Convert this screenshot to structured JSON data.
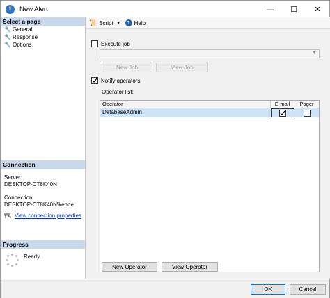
{
  "window": {
    "title": "New Alert",
    "minimize": "—",
    "maximize": "☐",
    "close": "✕"
  },
  "left_panel": {
    "select_page_header": "Select a page",
    "pages": [
      "General",
      "Response",
      "Options"
    ],
    "connection_header": "Connection",
    "server_label": "Server:",
    "server_value": "DESKTOP-CT8K40N",
    "connection_label": "Connection:",
    "connection_value": "DESKTOP-CT8K40N\\kenne",
    "view_connection_link": "View connection properties",
    "progress_header": "Progress",
    "progress_status": "Ready"
  },
  "toolbar": {
    "script_label": "Script",
    "help_label": "Help"
  },
  "main": {
    "execute_job_label": "Execute job",
    "execute_job_checked": false,
    "new_job_button": "New Job",
    "view_job_button": "View Job",
    "notify_operators_label": "Notify operators",
    "notify_operators_checked": true,
    "operator_list_label": "Operator list:",
    "table": {
      "headers": [
        "Operator",
        "E-mail",
        "Pager"
      ],
      "rows": [
        {
          "operator": "DatabaseAdmin",
          "email": true,
          "pager": false
        }
      ]
    },
    "new_operator_button": "New Operator",
    "view_operator_button": "View Operator"
  },
  "footer": {
    "ok_button": "OK",
    "cancel_button": "Cancel"
  },
  "colors": {
    "header_bg": "#c9d9ed",
    "row_selected": "#cde3f7",
    "link": "#0033cc",
    "accent": "#0078d7"
  }
}
